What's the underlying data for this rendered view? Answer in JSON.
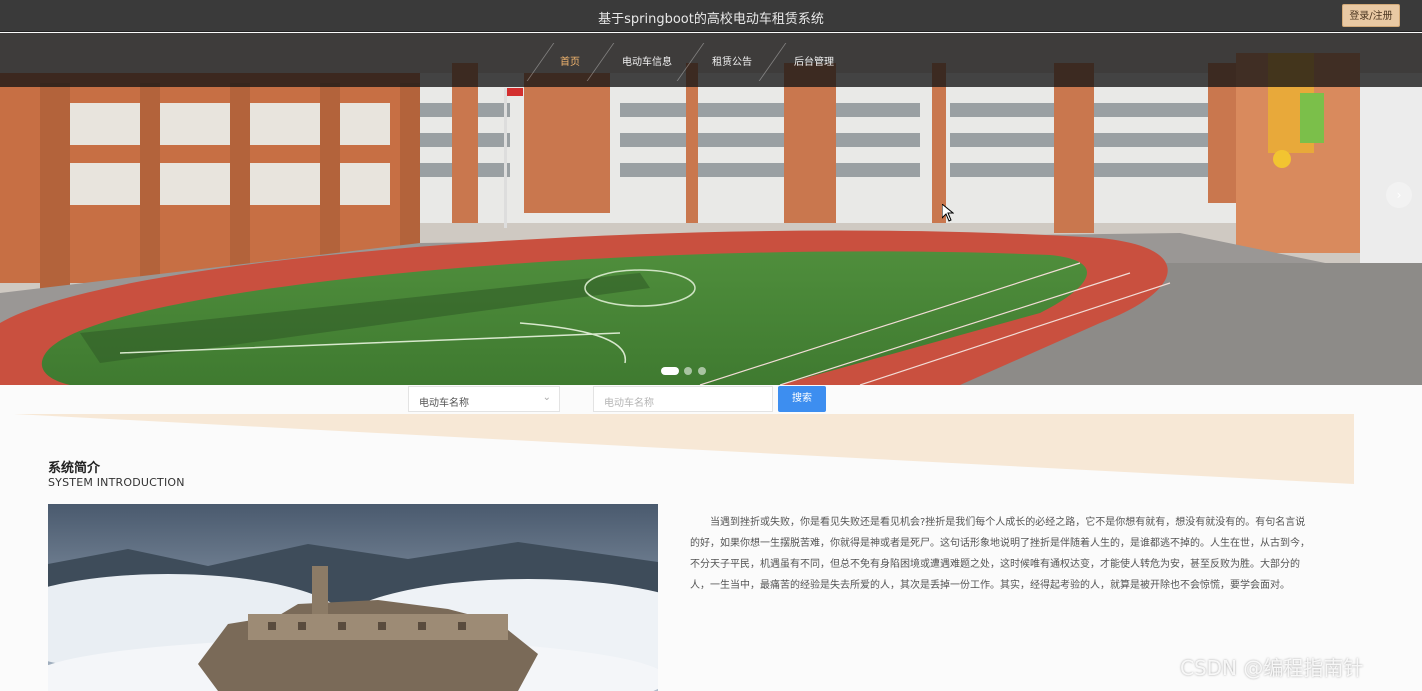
{
  "header": {
    "title": "基于springboot的高校电动车租赁系统",
    "login_label": "登录/注册"
  },
  "nav": {
    "items": [
      "首页",
      "电动车信息",
      "租赁公告",
      "后台管理"
    ],
    "active_index": 0
  },
  "banner": {
    "slide_count": 3,
    "active_slide": 0,
    "next_glyph": "›"
  },
  "search": {
    "field_select_value": "电动车名称",
    "input_placeholder": "电动车名称",
    "button_label": "搜索"
  },
  "intro": {
    "title": "系统简介",
    "subtitle": "SYSTEM INTRODUCTION",
    "body": "当遇到挫折或失败，你是看见失败还是看见机会?挫折是我们每个人成长的必经之路，它不是你想有就有，想没有就没有的。有句名言说的好，如果你想一生摆脱苦难，你就得是神或者是死尸。这句话形象地说明了挫折是伴随着人生的，是谁都逃不掉的。人生在世，从古到今，不分天子平民，机遇虽有不同，但总不免有身陷困境或遭遇难题之处，这时候唯有通权达变，才能使人转危为安，甚至反败为胜。大部分的人，一生当中，最痛苦的经验是失去所爱的人，其次是丢掉一份工作。其实，经得起考验的人，就算是被开除也不会惊慌，要学会面对。"
  },
  "watermark": "CSDN @编程指南针",
  "colors": {
    "accent": "#3d8ef0",
    "nav_active": "#f0b46e",
    "login_bg": "#e9c9a4",
    "band": "#f7e8d6"
  }
}
